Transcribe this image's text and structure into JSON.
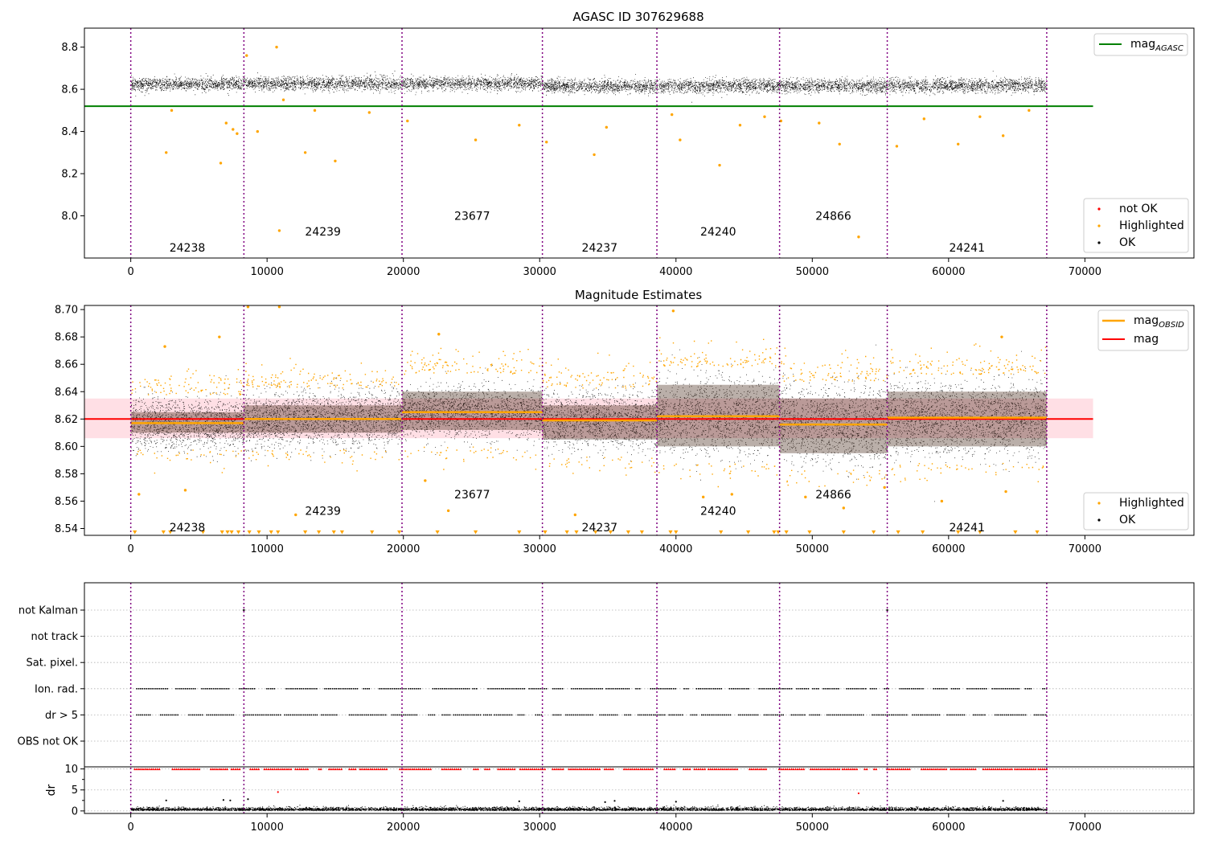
{
  "colors": {
    "ok": "#000000",
    "highlighted": "#ffa500",
    "not_ok": "#ff0000",
    "mag_agasc": "#008000",
    "mag": "#ff0000",
    "mag_obsid": "#ffa500",
    "obsid_divider": "#800080",
    "band": "#ffc0cb",
    "grid": "#b0b0b0"
  },
  "chart_data": [
    {
      "type": "scatter",
      "title": "AGASC ID 307629688",
      "xlim": [
        -3400,
        78000
      ],
      "ylim": [
        7.8,
        8.89
      ],
      "x_ticks": [
        0,
        10000,
        20000,
        30000,
        40000,
        50000,
        60000,
        70000
      ],
      "y_ticks": [
        8.0,
        8.2,
        8.4,
        8.6,
        8.8
      ],
      "y_tick_labels": [
        "8.0",
        "8.2",
        "8.4",
        "8.6",
        "8.8"
      ],
      "ok_band": {
        "x": [
          0,
          67200
        ],
        "lines": [
          {
            "x": [
              0,
              30200
            ],
            "y": [
              8.625,
              8.63
            ]
          },
          {
            "x": [
              30200,
              67200
            ],
            "y": [
              8.615,
              8.62
            ]
          }
        ],
        "spread": 0.035
      },
      "reference_lines": [
        {
          "name": "mag",
          "subscript": "AGASC",
          "y": 8.52,
          "x": [
            -3400,
            70600
          ],
          "color": "#008000"
        }
      ],
      "highlighted_points": [
        [
          2600,
          8.3
        ],
        [
          3000,
          8.5
        ],
        [
          6600,
          8.25
        ],
        [
          7000,
          8.44
        ],
        [
          7500,
          8.41
        ],
        [
          7800,
          8.39
        ],
        [
          8500,
          8.76
        ],
        [
          9300,
          8.4
        ],
        [
          10700,
          8.8
        ],
        [
          10900,
          7.93
        ],
        [
          11200,
          8.55
        ],
        [
          12800,
          8.3
        ],
        [
          13500,
          8.5
        ],
        [
          15000,
          8.26
        ],
        [
          17500,
          8.49
        ],
        [
          20300,
          8.45
        ],
        [
          25300,
          8.36
        ],
        [
          28500,
          8.43
        ],
        [
          30500,
          8.35
        ],
        [
          34000,
          8.29
        ],
        [
          34900,
          8.42
        ],
        [
          39700,
          8.48
        ],
        [
          40300,
          8.36
        ],
        [
          43200,
          8.24
        ],
        [
          44700,
          8.43
        ],
        [
          46500,
          8.47
        ],
        [
          47700,
          8.45
        ],
        [
          50500,
          8.44
        ],
        [
          52000,
          8.34
        ],
        [
          53400,
          7.9
        ],
        [
          56200,
          8.33
        ],
        [
          58200,
          8.46
        ],
        [
          60700,
          8.34
        ],
        [
          62300,
          8.47
        ],
        [
          64000,
          8.38
        ],
        [
          65900,
          8.5
        ]
      ],
      "not_ok_points": [],
      "obsids": [
        {
          "label": "24238",
          "start": 0,
          "end": 8300,
          "label_y": 7.85
        },
        {
          "label": "24239",
          "start": 8300,
          "end": 19900,
          "label_y": 7.925
        },
        {
          "label": "23677",
          "start": 19900,
          "end": 30200,
          "label_y": 8.0
        },
        {
          "label": "24237",
          "start": 30200,
          "end": 38600,
          "label_y": 7.85
        },
        {
          "label": "24240",
          "start": 38600,
          "end": 47600,
          "label_y": 7.925
        },
        {
          "label": "24866",
          "start": 47600,
          "end": 55500,
          "label_y": 8.0
        },
        {
          "label": "24241",
          "start": 55500,
          "end": 67200,
          "label_y": 7.85
        }
      ],
      "dividers": [
        0,
        8300,
        19900,
        30200,
        38600,
        47600,
        55500,
        67200
      ],
      "legend_top": {
        "position": "top-right",
        "entries": [
          {
            "label": "mag",
            "subscript": "AGASC"
          }
        ]
      },
      "legend_bottom": {
        "position": "lower-right",
        "entries": [
          {
            "label": "not OK"
          },
          {
            "label": "Highlighted"
          },
          {
            "label": "OK"
          }
        ]
      }
    },
    {
      "type": "scatter",
      "title": "Magnitude Estimates",
      "xlim": [
        -3400,
        78000
      ],
      "ylim": [
        8.535,
        8.703
      ],
      "x_ticks": [
        0,
        10000,
        20000,
        30000,
        40000,
        50000,
        60000,
        70000
      ],
      "y_ticks": [
        8.54,
        8.56,
        8.58,
        8.6,
        8.62,
        8.64,
        8.66,
        8.68,
        8.7
      ],
      "y_tick_labels": [
        "8.54",
        "8.56",
        "8.58",
        "8.60",
        "8.62",
        "8.64",
        "8.66",
        "8.68",
        "8.70"
      ],
      "mag": 8.62,
      "mag_band": [
        8.606,
        8.635
      ],
      "mag_line_x": [
        -3400,
        70600
      ],
      "obsid_mags": [
        {
          "label": "24238",
          "start": 0,
          "end": 8300,
          "mag": 8.617,
          "low": 8.61,
          "high": 8.625,
          "spread": 0.02,
          "label_y": 8.541
        },
        {
          "label": "24239",
          "start": 8300,
          "end": 19900,
          "mag": 8.62,
          "low": 8.61,
          "high": 8.63,
          "spread": 0.022,
          "label_y": 8.553
        },
        {
          "label": "23677",
          "start": 19900,
          "end": 30200,
          "mag": 8.625,
          "low": 8.612,
          "high": 8.64,
          "spread": 0.02,
          "label_y": 8.565
        },
        {
          "label": "24237",
          "start": 30200,
          "end": 38600,
          "mag": 8.619,
          "low": 8.605,
          "high": 8.63,
          "spread": 0.022,
          "label_y": 8.541
        },
        {
          "label": "24240",
          "start": 38600,
          "end": 47600,
          "mag": 8.622,
          "low": 8.6,
          "high": 8.645,
          "spread": 0.03,
          "label_y": 8.553
        },
        {
          "label": "24866",
          "start": 47600,
          "end": 55500,
          "mag": 8.616,
          "low": 8.595,
          "high": 8.635,
          "spread": 0.03,
          "label_y": 8.565
        },
        {
          "label": "24241",
          "start": 55500,
          "end": 67200,
          "mag": 8.621,
          "low": 8.6,
          "high": 8.64,
          "spread": 0.028,
          "label_y": 8.541
        }
      ],
      "highlighted_points": [
        [
          2500,
          8.673
        ],
        [
          6500,
          8.68
        ],
        [
          8600,
          8.702
        ],
        [
          10900,
          8.702
        ],
        [
          22600,
          8.682
        ],
        [
          39800,
          8.699
        ],
        [
          63900,
          8.68
        ],
        [
          600,
          8.565
        ],
        [
          4000,
          8.568
        ],
        [
          12100,
          8.55
        ],
        [
          21600,
          8.575
        ],
        [
          23300,
          8.553
        ],
        [
          32600,
          8.55
        ],
        [
          42000,
          8.563
        ],
        [
          44100,
          8.565
        ],
        [
          49500,
          8.563
        ],
        [
          52300,
          8.555
        ],
        [
          55300,
          8.57
        ],
        [
          59500,
          8.56
        ],
        [
          64200,
          8.567
        ]
      ],
      "censored_points_x": [
        300,
        2400,
        2900,
        5300,
        6700,
        7100,
        7400,
        7900,
        8700,
        9400,
        10300,
        10800,
        12800,
        13800,
        14900,
        15500,
        17700,
        19700,
        22500,
        25300,
        28500,
        30400,
        32000,
        32700,
        34100,
        35200,
        36500,
        37500,
        39600,
        40000,
        43300,
        45300,
        47200,
        47500,
        48100,
        49800,
        52300,
        54500,
        56300,
        58100,
        60700,
        62300,
        64900,
        66500
      ],
      "obsids": [
        {
          "label": "24238"
        },
        {
          "label": "24239"
        },
        {
          "label": "23677"
        },
        {
          "label": "24237"
        },
        {
          "label": "24240"
        },
        {
          "label": "24866"
        },
        {
          "label": "24241"
        }
      ],
      "dividers": [
        0,
        8300,
        19900,
        30200,
        38600,
        47600,
        55500,
        67200
      ],
      "legend_top": {
        "position": "top-right",
        "entries": [
          {
            "label": "mag",
            "subscript": "OBSID"
          },
          {
            "label": "mag"
          }
        ]
      },
      "legend_bottom": {
        "position": "lower-right",
        "entries": [
          {
            "label": "Highlighted"
          },
          {
            "label": "OK"
          }
        ]
      }
    },
    {
      "type": "scatter",
      "title": "",
      "xlim": [
        -3400,
        78000
      ],
      "flag_rows": [
        "not Kalman",
        "not track",
        "Sat. pixel.",
        "Ion. rad.",
        "dr > 5",
        "OBS not OK"
      ],
      "flag_spans": [
        {
          "row": "Ion. rad.",
          "x": [
            0,
            67200
          ]
        },
        {
          "row": "dr > 5",
          "x": [
            0,
            67200
          ]
        }
      ],
      "flag_isolated": [
        {
          "row": "not Kalman",
          "x": [
            8300,
            55500
          ]
        }
      ],
      "dr_ylim": [
        -0.6,
        10.5
      ],
      "dr_ticks": [
        0,
        5,
        10
      ],
      "dr_ylabel": "dr",
      "dr_clip_value": 10,
      "dr_outliers": [
        [
          2600,
          2.5
        ],
        [
          6800,
          2.6
        ],
        [
          7300,
          2.5
        ],
        [
          8600,
          2.8
        ],
        [
          10800,
          4.5
        ],
        [
          28500,
          2.3
        ],
        [
          34800,
          2.1
        ],
        [
          35500,
          2.4
        ],
        [
          40000,
          2.2
        ],
        [
          53400,
          4.2
        ],
        [
          64000,
          2.4
        ]
      ],
      "x_ticks": [
        0,
        10000,
        20000,
        30000,
        40000,
        50000,
        60000,
        70000
      ],
      "dividers": [
        0,
        8300,
        19900,
        30200,
        38600,
        47600,
        55500,
        67200
      ]
    }
  ]
}
